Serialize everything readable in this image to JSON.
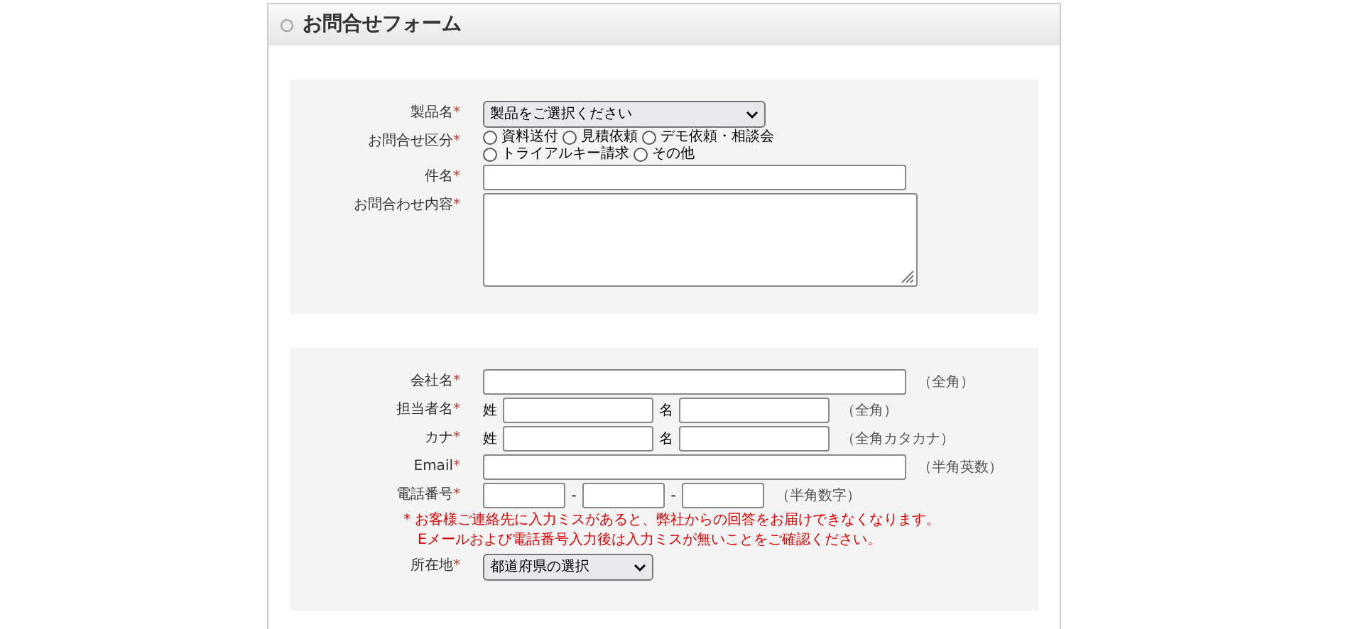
{
  "title": "お問合せフォーム",
  "sections": [
    {
      "fields": [
        {
          "kind": "wide_select",
          "label": "製品名",
          "required_mark": "*",
          "value": "製品をご選択ください"
        },
        {
          "kind": "radio",
          "label": "お問合せ区分",
          "required_mark": "*",
          "options": [
            {
              "label": "資料送付",
              "selected": false
            },
            {
              "label": "見積依頼",
              "selected": false
            },
            {
              "label": "デモ依頼・相談会",
              "selected": false
            },
            {
              "label": "トライアルキー請求",
              "selected": false
            },
            {
              "label": "その他",
              "selected": false
            }
          ]
        },
        {
          "kind": "text",
          "label": "件名",
          "required_mark": "*"
        },
        {
          "kind": "textarea",
          "label": "お問合わせ内容",
          "required_mark": "*"
        }
      ]
    },
    {
      "fields": [
        {
          "kind": "text",
          "label": "会社名",
          "required_mark": "*",
          "hint": "（全角）"
        },
        {
          "kind": "name_pair",
          "label": "担当者名",
          "required_mark": "*",
          "parts": [
            "姓",
            "名"
          ],
          "hint": "（全角）"
        },
        {
          "kind": "name_pair",
          "label": "カナ",
          "required_mark": "*",
          "parts": [
            "姓",
            "名"
          ],
          "hint": "（全角カタカナ）"
        },
        {
          "kind": "text",
          "label": "Email",
          "required_mark": "*",
          "hint": "（半角英数）"
        },
        {
          "kind": "tel",
          "label": "電話番号",
          "required_mark": "*",
          "separators": [
            "-",
            "-"
          ],
          "hint": "（半角数字）"
        },
        {
          "kind": "note",
          "lines": [
            "* お客様ご連絡先に入力ミスがあると、弊社からの回答をお届けできなくなります。",
            "Eメールおよび電話番号入力後は入力ミスが無いことをご確認ください。"
          ]
        },
        {
          "kind": "select",
          "label": "所在地",
          "required_mark": "*",
          "value": "都道府県の選択"
        }
      ]
    }
  ]
}
